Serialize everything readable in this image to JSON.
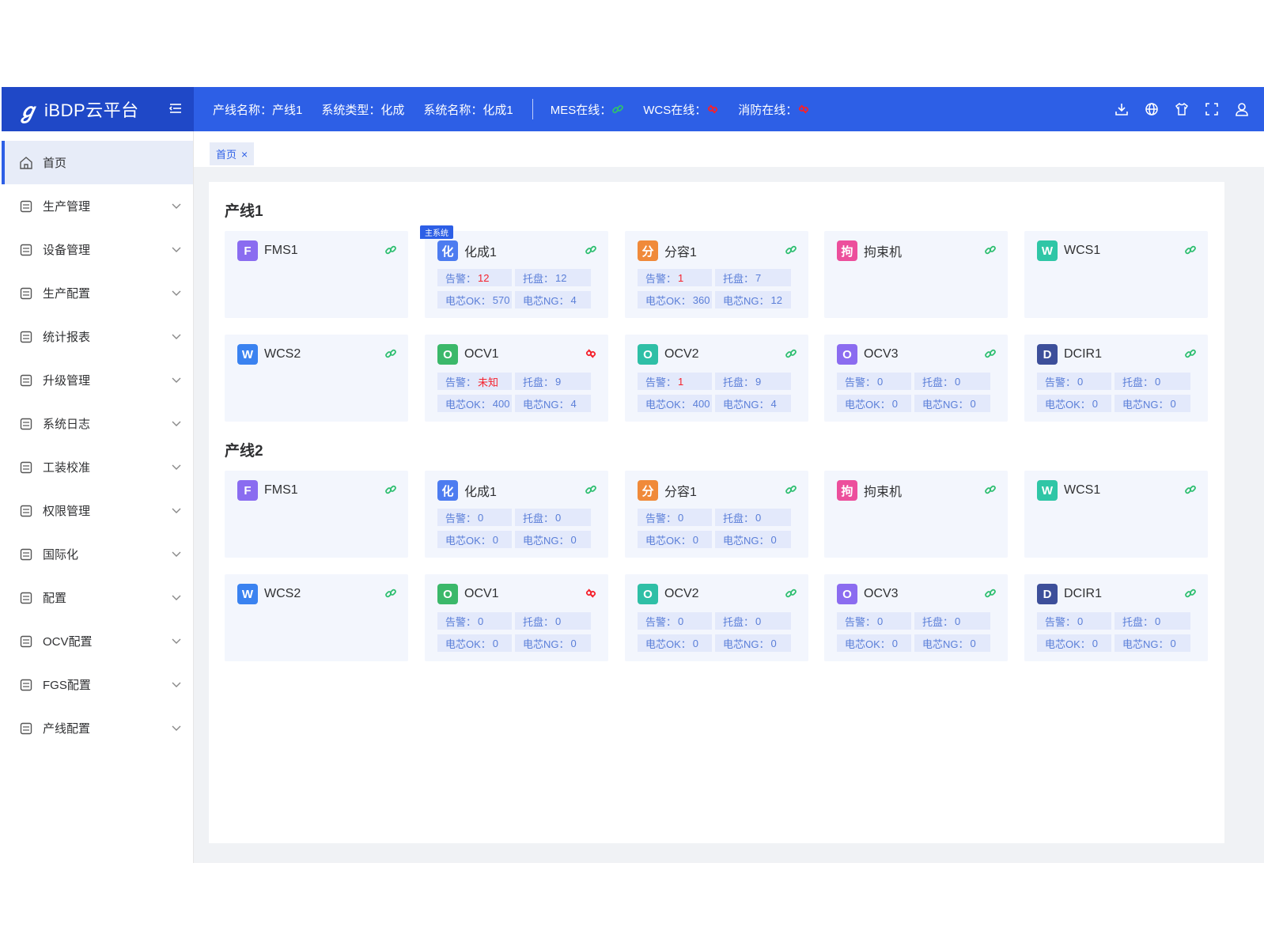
{
  "app": {
    "title": "iBDP云平台"
  },
  "header": {
    "line_name_label": "产线名称：",
    "line_name": "产线1",
    "system_type_label": "系统类型：",
    "system_type": "化成",
    "system_name_label": "系统名称：",
    "system_name": "化成1",
    "mes_label": "MES在线：",
    "mes_online": true,
    "wcs_label": "WCS在线：",
    "wcs_online": false,
    "fire_label": "消防在线：",
    "fire_online": false,
    "icons": [
      "download-icon",
      "globe-icon",
      "shirt-icon",
      "fullscreen-icon",
      "user-icon"
    ]
  },
  "sidebar": {
    "items": [
      {
        "label": "首页",
        "icon": "home-icon",
        "active": true,
        "expandable": false
      },
      {
        "label": "生产管理",
        "icon": "box-icon",
        "expandable": true
      },
      {
        "label": "设备管理",
        "icon": "device-icon",
        "expandable": true
      },
      {
        "label": "生产配置",
        "icon": "grid-icon",
        "expandable": true
      },
      {
        "label": "统计报表",
        "icon": "chart-icon",
        "expandable": true
      },
      {
        "label": "升级管理",
        "icon": "upgrade-icon",
        "expandable": true
      },
      {
        "label": "系统日志",
        "icon": "log-icon",
        "expandable": true
      },
      {
        "label": "工装校准",
        "icon": "calibrate-icon",
        "expandable": true
      },
      {
        "label": "权限管理",
        "icon": "shield-icon",
        "expandable": true
      },
      {
        "label": "国际化",
        "icon": "globe-icon",
        "expandable": true
      },
      {
        "label": "配置",
        "icon": "config-icon",
        "expandable": true
      },
      {
        "label": "OCV配置",
        "icon": "ocv-config-icon",
        "expandable": true
      },
      {
        "label": "FGS配置",
        "icon": "fgs-config-icon",
        "expandable": true
      },
      {
        "label": "产线配置",
        "icon": "line-config-icon",
        "expandable": true
      }
    ]
  },
  "tabs": [
    {
      "label": "首页",
      "closable": true
    }
  ],
  "labels": {
    "alarm": "告警：",
    "tray": "托盘：",
    "cell_ok": "电芯OK：",
    "cell_ng": "电芯NG：",
    "main_system": "主系统"
  },
  "colors": {
    "primary": "#2d5fe6",
    "online": "#2fbf71",
    "offline": "#f5222d"
  },
  "lines": [
    {
      "title": "产线1",
      "devices": [
        {
          "name": "FMS1",
          "glyph": "F",
          "color": "#8a6cf0",
          "online": true,
          "stats": null
        },
        {
          "name": "化成1",
          "glyph": "化",
          "color": "#4d7cf0",
          "online": true,
          "main": true,
          "stats": {
            "alarm": "12",
            "alarm_red": true,
            "tray": "12",
            "ok": "570",
            "ng": "4"
          }
        },
        {
          "name": "分容1",
          "glyph": "分",
          "color": "#f08a3a",
          "online": true,
          "stats": {
            "alarm": "1",
            "alarm_red": true,
            "tray": "7",
            "ok": "360",
            "ng": "12"
          }
        },
        {
          "name": "拘束机",
          "glyph": "拘",
          "color": "#ec4f9c",
          "online": true,
          "stats": null
        },
        {
          "name": "WCS1",
          "glyph": "W",
          "color": "#2fc6a6",
          "online": true,
          "stats": null
        },
        {
          "name": "WCS2",
          "glyph": "W",
          "color": "#3a82f0",
          "online": true,
          "stats": null
        },
        {
          "name": "OCV1",
          "glyph": "O",
          "color": "#3bb86a",
          "online": false,
          "stats": {
            "alarm": "未知",
            "alarm_red": true,
            "tray": "9",
            "ok": "400",
            "ng": "4"
          }
        },
        {
          "name": "OCV2",
          "glyph": "O",
          "color": "#2fbfa6",
          "online": true,
          "stats": {
            "alarm": "1",
            "alarm_red": true,
            "tray": "9",
            "ok": "400",
            "ng": "4"
          }
        },
        {
          "name": "OCV3",
          "glyph": "O",
          "color": "#8b6cf0",
          "online": true,
          "stats": {
            "alarm": "0",
            "alarm_red": false,
            "tray": "0",
            "ok": "0",
            "ng": "0"
          }
        },
        {
          "name": "DCIR1",
          "glyph": "D",
          "color": "#3d4f9a",
          "online": true,
          "stats": {
            "alarm": "0",
            "alarm_red": false,
            "tray": "0",
            "ok": "0",
            "ng": "0"
          }
        }
      ]
    },
    {
      "title": "产线2",
      "devices": [
        {
          "name": "FMS1",
          "glyph": "F",
          "color": "#8a6cf0",
          "online": true,
          "stats": null
        },
        {
          "name": "化成1",
          "glyph": "化",
          "color": "#4d7cf0",
          "online": true,
          "stats": {
            "alarm": "0",
            "alarm_red": false,
            "tray": "0",
            "ok": "0",
            "ng": "0"
          }
        },
        {
          "name": "分容1",
          "glyph": "分",
          "color": "#f08a3a",
          "online": true,
          "stats": {
            "alarm": "0",
            "alarm_red": false,
            "tray": "0",
            "ok": "0",
            "ng": "0"
          }
        },
        {
          "name": "拘束机",
          "glyph": "拘",
          "color": "#ec4f9c",
          "online": true,
          "stats": null
        },
        {
          "name": "WCS1",
          "glyph": "W",
          "color": "#2fc6a6",
          "online": true,
          "stats": null
        },
        {
          "name": "WCS2",
          "glyph": "W",
          "color": "#3a82f0",
          "online": true,
          "stats": null
        },
        {
          "name": "OCV1",
          "glyph": "O",
          "color": "#3bb86a",
          "online": false,
          "stats": {
            "alarm": "0",
            "alarm_red": false,
            "tray": "0",
            "ok": "0",
            "ng": "0"
          }
        },
        {
          "name": "OCV2",
          "glyph": "O",
          "color": "#2fbfa6",
          "online": true,
          "stats": {
            "alarm": "0",
            "alarm_red": false,
            "tray": "0",
            "ok": "0",
            "ng": "0"
          }
        },
        {
          "name": "OCV3",
          "glyph": "O",
          "color": "#8b6cf0",
          "online": true,
          "stats": {
            "alarm": "0",
            "alarm_red": false,
            "tray": "0",
            "ok": "0",
            "ng": "0"
          }
        },
        {
          "name": "DCIR1",
          "glyph": "D",
          "color": "#3d4f9a",
          "online": true,
          "stats": {
            "alarm": "0",
            "alarm_red": false,
            "tray": "0",
            "ok": "0",
            "ng": "0"
          }
        }
      ]
    }
  ]
}
